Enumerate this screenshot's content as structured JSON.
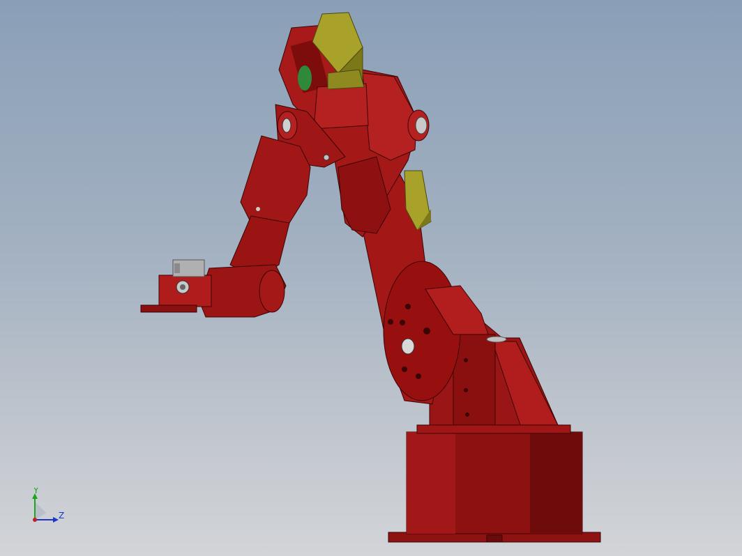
{
  "viewport": {
    "background_top": "#8a9fb7",
    "background_bottom": "#d2d4d8"
  },
  "model": {
    "part_colors": {
      "body": "#9e1414",
      "body_shade": "#6d0b0b",
      "body_light": "#b82020",
      "motor": "#a8a12a",
      "motor_shade": "#7c7718",
      "gear": "#2e8a3a"
    }
  },
  "triad": {
    "y_label": "Y",
    "z_label": "Z",
    "y_color": "#1aa51a",
    "z_color": "#1b36c7",
    "origin_color": "#c81e1e",
    "icon": "view-orientation-triad-icon"
  }
}
